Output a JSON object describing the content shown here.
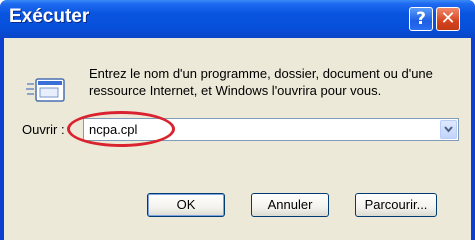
{
  "window": {
    "title": "Exécuter",
    "help_glyph": "?",
    "close_glyph": "✕"
  },
  "dialog": {
    "message": "Entrez le nom d'un programme, dossier, document ou d'une ressource Internet, et Windows l'ouvrira pour vous.",
    "open_label": "Ouvrir :",
    "open_value": "ncpa.cpl",
    "icon": "run-icon"
  },
  "buttons": {
    "ok": "OK",
    "cancel": "Annuler",
    "browse": "Parcourir..."
  },
  "colors": {
    "titlebar": "#0a55e0",
    "client": "#ece9d8",
    "highlight": "#d9232e"
  }
}
